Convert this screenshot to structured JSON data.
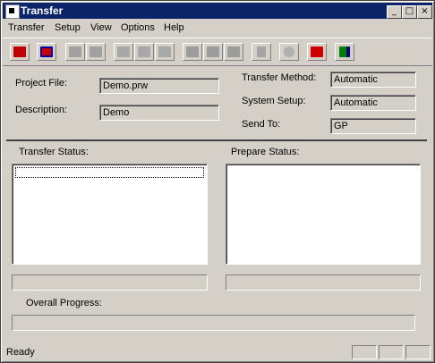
{
  "window": {
    "title": "Transfer"
  },
  "menu": [
    "Transfer",
    "Setup",
    "View",
    "Options",
    "Help"
  ],
  "toolbar_icons": [
    "send-icon",
    "receive-icon",
    "sys-icon",
    "sys-all-icon",
    "bk-icon",
    "bk-all-icon",
    "bk-send-icon",
    "prepare-icon",
    "prepare-all-icon",
    "send-batch-icon",
    "delete-icon",
    "stop-icon",
    "help-icon",
    "exit-icon"
  ],
  "form": {
    "project_file_label": "Project File:",
    "project_file_value": "Demo.prw",
    "description_label": "Description:",
    "description_value": "Demo",
    "transfer_method_label": "Transfer Method:",
    "transfer_method_value": "Automatic",
    "system_setup_label": "System Setup:",
    "system_setup_value": "Automatic",
    "send_to_label": "Send To:",
    "send_to_value": "GP"
  },
  "transfer_status_label": "Transfer Status:",
  "prepare_status_label": "Prepare Status:",
  "overall_progress_label": "Overall Progress:",
  "status": {
    "text": "Ready"
  }
}
